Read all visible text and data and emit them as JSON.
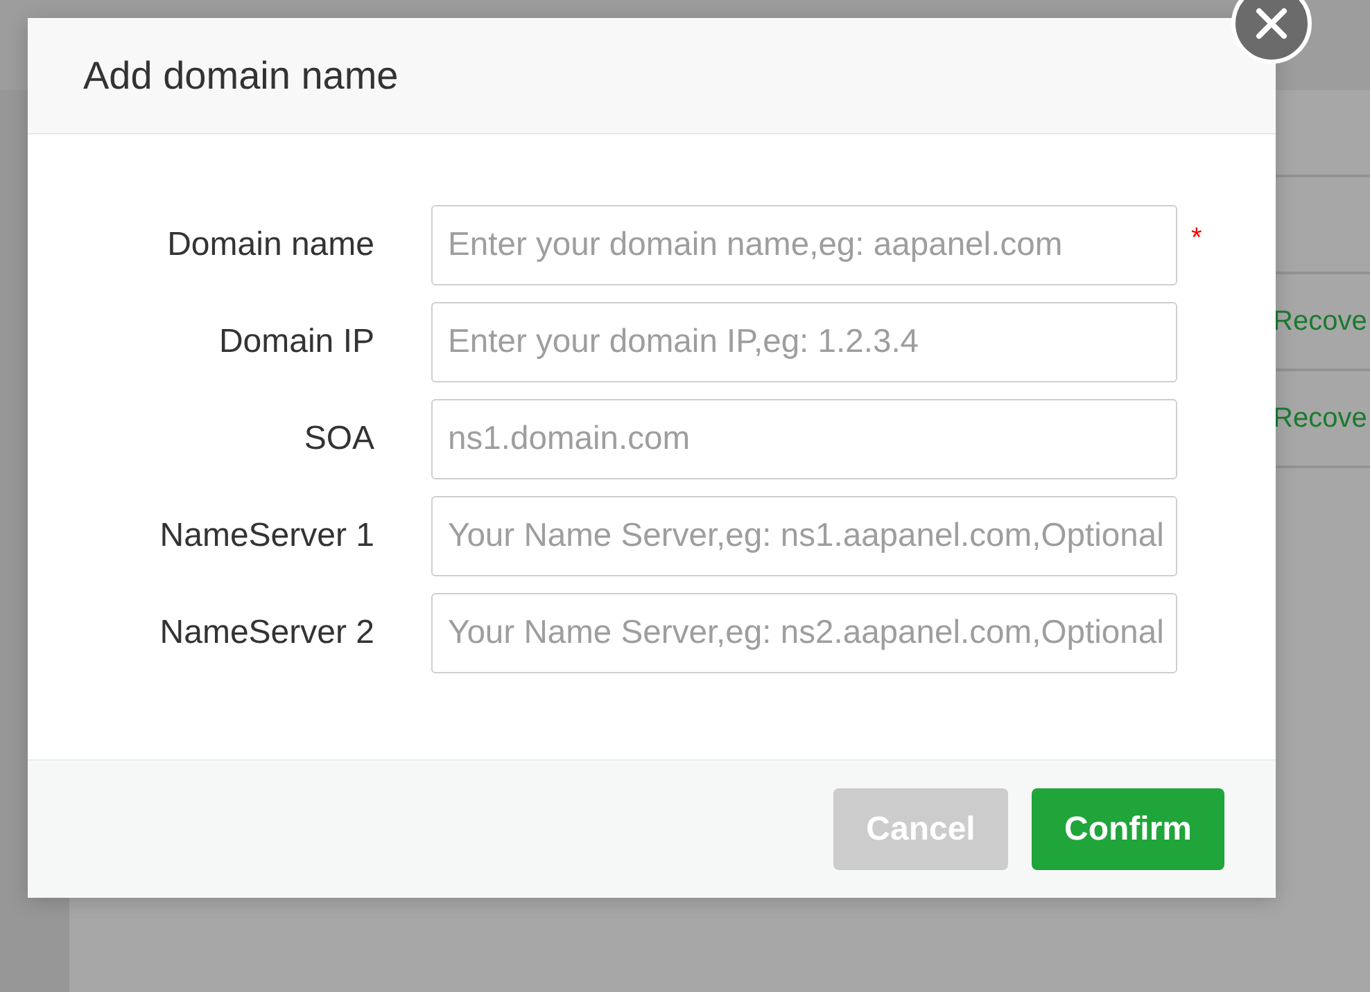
{
  "background": {
    "rows": [
      {
        "action": "Recove"
      },
      {
        "action": "Recove"
      }
    ]
  },
  "dialog": {
    "title": "Add domain name",
    "required_mark": "*",
    "fields": [
      {
        "label": "Domain name",
        "placeholder": "Enter your domain name,eg: aapanel.com",
        "required": true
      },
      {
        "label": "Domain IP",
        "placeholder": "Enter your domain IP,eg: 1.2.3.4",
        "required": false
      },
      {
        "label": "SOA",
        "placeholder": "ns1.domain.com",
        "required": false
      },
      {
        "label": "NameServer 1",
        "placeholder": "Your Name Server,eg: ns1.aapanel.com,Optional",
        "required": false
      },
      {
        "label": "NameServer 2",
        "placeholder": "Your Name Server,eg: ns2.aapanel.com,Optional",
        "required": false
      }
    ],
    "buttons": [
      {
        "label": "Cancel",
        "kind": "secondary"
      },
      {
        "label": "Confirm",
        "kind": "primary"
      }
    ]
  }
}
